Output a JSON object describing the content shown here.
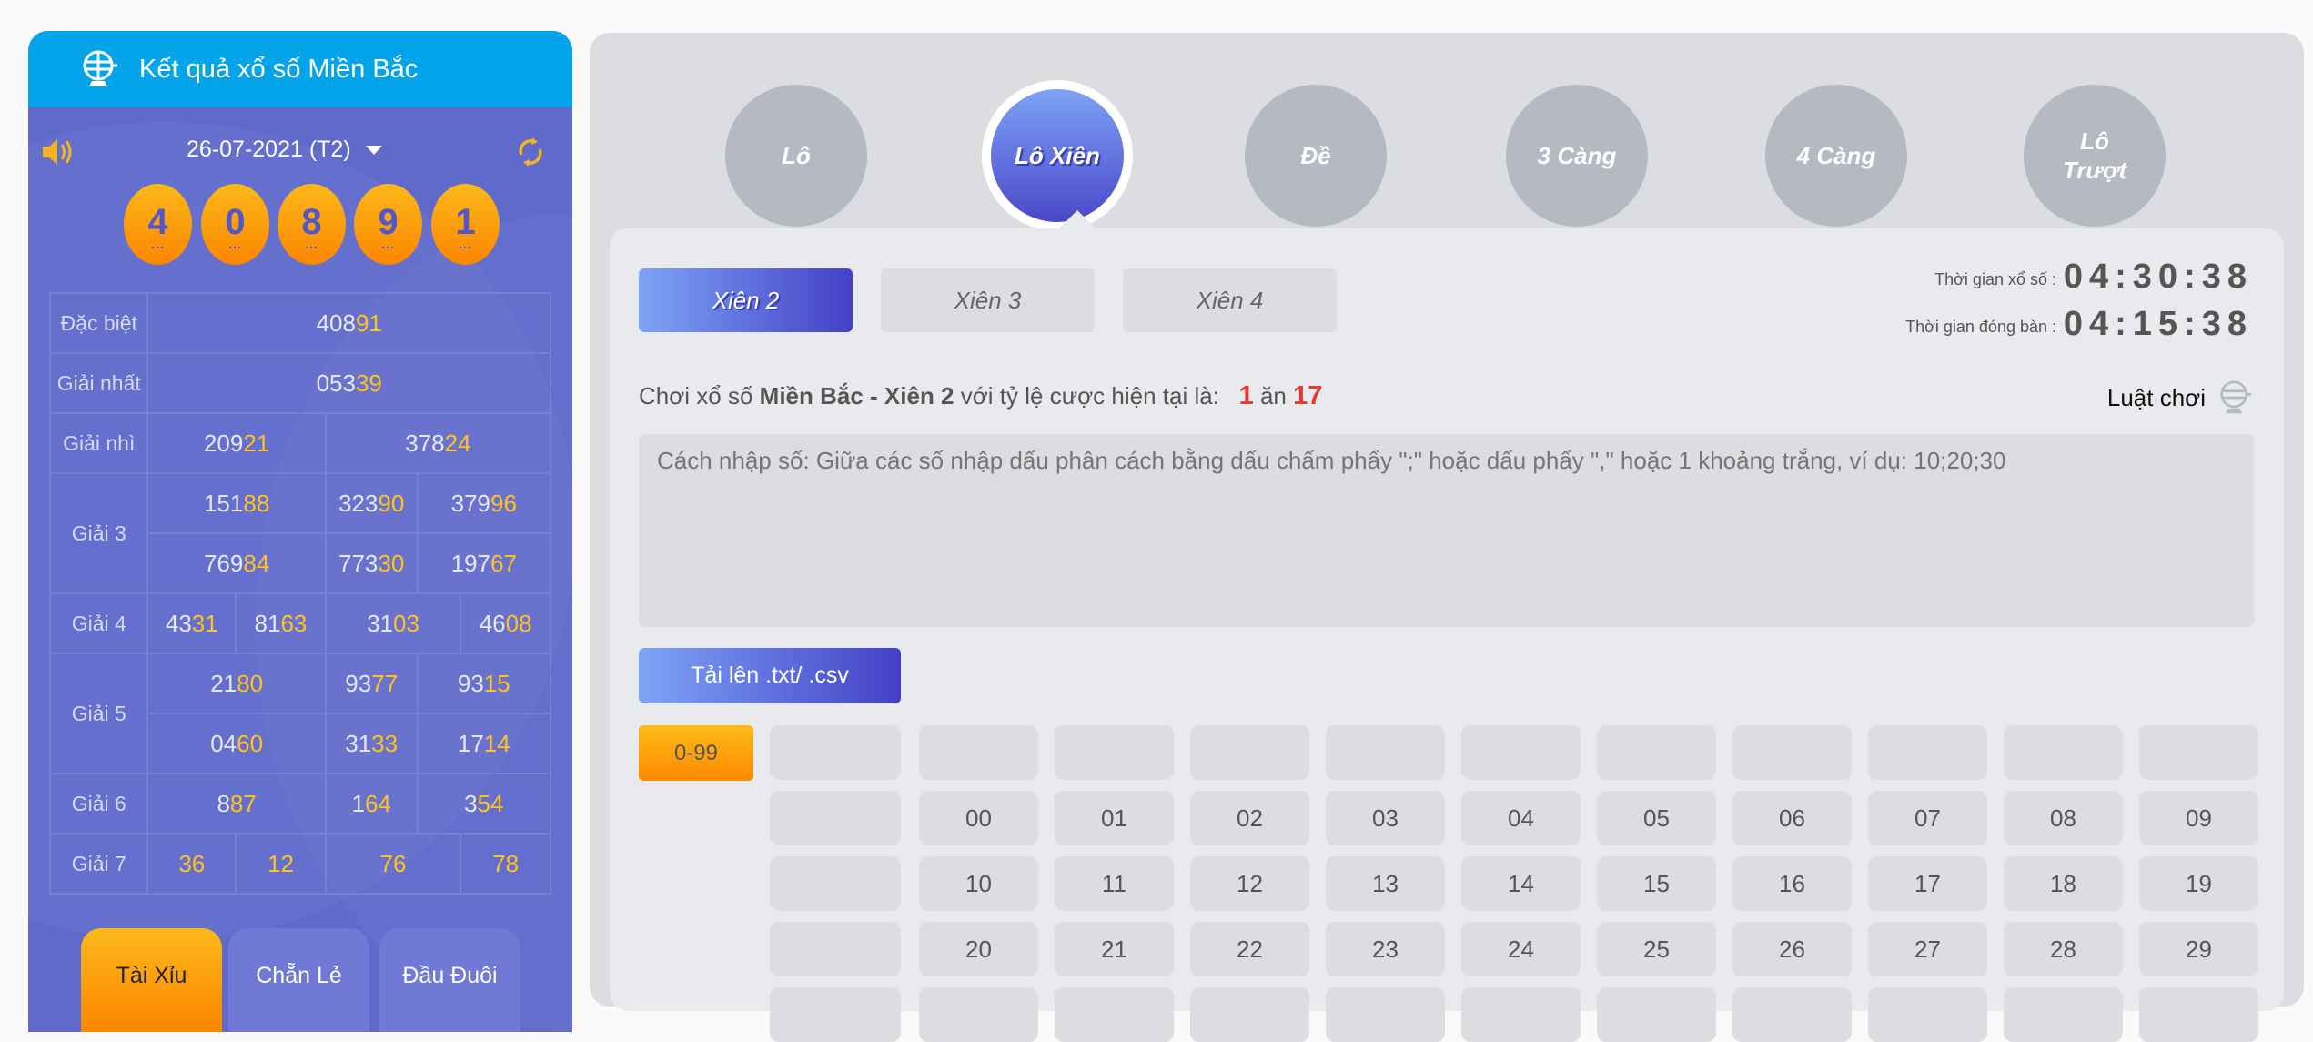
{
  "left": {
    "title": "Kết quả xổ số Miền Bắc",
    "date": "26-07-2021 (T2)",
    "balls": [
      "4",
      "0",
      "8",
      "9",
      "1"
    ],
    "prizes": [
      {
        "label": "Đặc biệt",
        "numbers": [
          "40891"
        ]
      },
      {
        "label": "Giải nhất",
        "numbers": [
          "05339"
        ]
      },
      {
        "label": "Giải nhì",
        "numbers": [
          "20921",
          "37824"
        ]
      },
      {
        "label": "Giải 3",
        "numbers": [
          "15188",
          "32390",
          "37996",
          "76984",
          "77330",
          "19767"
        ]
      },
      {
        "label": "Giải 4",
        "numbers": [
          "4331",
          "8163",
          "3103",
          "4608"
        ]
      },
      {
        "label": "Giải 5",
        "numbers": [
          "2180",
          "9377",
          "9315",
          "0460",
          "3133",
          "1714"
        ]
      },
      {
        "label": "Giải 6",
        "numbers": [
          "887",
          "164",
          "354"
        ]
      },
      {
        "label": "Giải 7",
        "numbers": [
          "36",
          "12",
          "76",
          "78"
        ]
      }
    ],
    "buttons": [
      "Tài Xỉu",
      "Chẵn Lẻ",
      "Đầu Đuôi"
    ],
    "active_button": 0,
    "colors": {
      "header": "#03a4ea",
      "panel": "#5f6acb",
      "highlight": "#ffc21e"
    }
  },
  "main": {
    "game_tabs": [
      "Lô",
      "Lô Xiên",
      "Đề",
      "3 Càng",
      "4 Càng",
      "Lô Trượt"
    ],
    "active_game": 1,
    "sub_tabs": [
      "Xiên 2",
      "Xiên 3",
      "Xiên 4"
    ],
    "active_sub": 0,
    "timers": [
      {
        "label": "Thời gian xổ số :",
        "value": "04:30:38"
      },
      {
        "label": "Thời gian đóng bàn :",
        "value": "04:15:38"
      }
    ],
    "rate": {
      "prefix": "Chơi xổ số",
      "bold": "Miền Bắc - Xiên 2",
      "middle": "với tỷ lệ cược hiện tại là:",
      "a": "1",
      "sep": "ăn",
      "b": "17"
    },
    "rules_label": "Luật chơi",
    "hint": "Cách nhập số: Giữa các số nhập dấu phân cách bằng dấu chấm phẩy \";\" hoặc dấu phẩy \",\" hoặc 1 khoảng trắng, ví dụ: 10;20;30",
    "upload_label": "Tải lên .txt/ .csv",
    "range_label": "0-99",
    "number_rows": [
      [
        "",
        "",
        "",
        "",
        "",
        "",
        "",
        "",
        "",
        ""
      ],
      [
        "00",
        "01",
        "02",
        "03",
        "04",
        "05",
        "06",
        "07",
        "08",
        "09"
      ],
      [
        "10",
        "11",
        "12",
        "13",
        "14",
        "15",
        "16",
        "17",
        "18",
        "19"
      ],
      [
        "20",
        "21",
        "22",
        "23",
        "24",
        "25",
        "26",
        "27",
        "28",
        "29"
      ],
      [
        "",
        "",
        "",
        "",
        "",
        "",
        "",
        "",
        "",
        ""
      ]
    ]
  }
}
